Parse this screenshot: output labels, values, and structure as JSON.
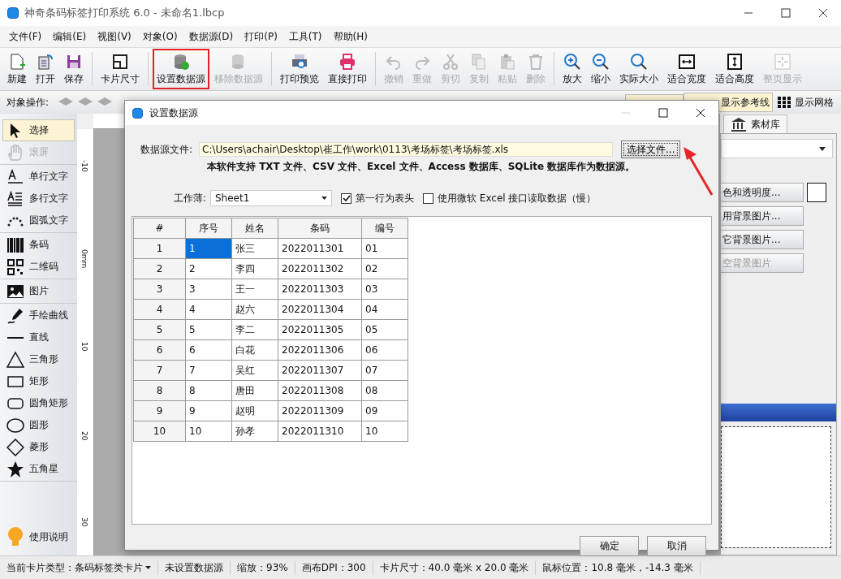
{
  "window": {
    "title": "神奇条码标签打印系统 6.0 - 未命名1.lbcp"
  },
  "menu": [
    "文件(F)",
    "编辑(E)",
    "视图(V)",
    "对象(O)",
    "数据源(D)",
    "打印(P)",
    "工具(T)",
    "帮助(H)"
  ],
  "toolbar": [
    [
      {
        "label": "新建",
        "disabled": false,
        "marked": false
      },
      {
        "label": "打开",
        "disabled": false,
        "marked": false
      },
      {
        "label": "保存",
        "disabled": false,
        "marked": false
      }
    ],
    [
      {
        "label": "卡片尺寸",
        "disabled": false,
        "marked": false
      }
    ],
    [
      {
        "label": "设置数据源",
        "disabled": false,
        "marked": true
      },
      {
        "label": "移除数据源",
        "disabled": true,
        "marked": false
      }
    ],
    [
      {
        "label": "打印预览",
        "disabled": false,
        "marked": false
      },
      {
        "label": "直接打印",
        "disabled": false,
        "marked": false
      }
    ],
    [
      {
        "label": "撤销",
        "disabled": true,
        "marked": false
      },
      {
        "label": "重做",
        "disabled": true,
        "marked": false
      },
      {
        "label": "剪切",
        "disabled": true,
        "marked": false
      },
      {
        "label": "复制",
        "disabled": true,
        "marked": false
      },
      {
        "label": "粘贴",
        "disabled": true,
        "marked": false
      },
      {
        "label": "删除",
        "disabled": true,
        "marked": false
      }
    ],
    [
      {
        "label": "放大",
        "disabled": false,
        "marked": false
      },
      {
        "label": "缩小",
        "disabled": false,
        "marked": false
      },
      {
        "label": "实际大小",
        "disabled": false,
        "marked": false
      },
      {
        "label": "适合宽度",
        "disabled": false,
        "marked": false
      },
      {
        "label": "适合高度",
        "disabled": false,
        "marked": false
      },
      {
        "label": "整页显示",
        "disabled": true,
        "marked": false
      }
    ]
  ],
  "object_bar": {
    "label": "对象操作:",
    "toggles": [
      {
        "label": "显示参考线",
        "on": true
      },
      {
        "label": "显示网格",
        "on": false
      }
    ]
  },
  "tools": [
    [
      {
        "label": "选择",
        "selected": true,
        "disabled": false
      },
      {
        "label": "滚屏",
        "selected": false,
        "disabled": true
      }
    ],
    [
      {
        "label": "单行文字",
        "selected": false,
        "disabled": false
      },
      {
        "label": "多行文字",
        "selected": false,
        "disabled": false
      },
      {
        "label": "圆弧文字",
        "selected": false,
        "disabled": false
      }
    ],
    [
      {
        "label": "条码",
        "selected": false,
        "disabled": false
      },
      {
        "label": "二维码",
        "selected": false,
        "disabled": false
      }
    ],
    [
      {
        "label": "图片",
        "selected": false,
        "disabled": false
      }
    ],
    [
      {
        "label": "手绘曲线",
        "selected": false,
        "disabled": false
      },
      {
        "label": "直线",
        "selected": false,
        "disabled": false
      },
      {
        "label": "三角形",
        "selected": false,
        "disabled": false
      },
      {
        "label": "矩形",
        "selected": false,
        "disabled": false
      },
      {
        "label": "圆角矩形",
        "selected": false,
        "disabled": false
      },
      {
        "label": "圆形",
        "selected": false,
        "disabled": false
      },
      {
        "label": "菱形",
        "selected": false,
        "disabled": false
      },
      {
        "label": "五角星",
        "selected": false,
        "disabled": false
      }
    ]
  ],
  "help": "使用说明",
  "ruler": [
    "-10",
    "0mm",
    "10",
    "20",
    "30"
  ],
  "right_panel": {
    "tab": "素材库",
    "buttons": [
      {
        "label": "色和透明度...",
        "disabled": false
      },
      {
        "label": "用背景图片...",
        "disabled": false
      },
      {
        "label": "它背景图片...",
        "disabled": false
      },
      {
        "label": "空背景图片",
        "disabled": true
      }
    ]
  },
  "dialog": {
    "title": "设置数据源",
    "file_label": "数据源文件:",
    "file_value": "C:\\Users\\achair\\Desktop\\崔工作\\work\\0113\\考场标签\\考场标签.xls",
    "browse": "选择文件...",
    "note": "本软件支持 TXT 文件、CSV 文件、Excel 文件、Access 数据库、SQLite 数据库作为数据源。",
    "sheet_label": "工作薄:",
    "sheet": "Sheet1",
    "options": [
      {
        "label": "第一行为表头",
        "checked": true
      },
      {
        "label": "使用微软 Excel 接口读取数据（慢）",
        "checked": false
      }
    ],
    "table": {
      "columns": [
        "#",
        "序号",
        "姓名",
        "条码",
        "编号"
      ],
      "rows": [
        {
          "cells": [
            {
              "text": "1",
              "selected": false
            },
            {
              "text": "1",
              "selected": true
            },
            {
              "text": "张三",
              "selected": false
            },
            {
              "text": "2022011301",
              "selected": false
            },
            {
              "text": "01",
              "selected": false
            }
          ]
        },
        {
          "cells": [
            {
              "text": "2",
              "selected": false
            },
            {
              "text": "2",
              "selected": false
            },
            {
              "text": "李四",
              "selected": false
            },
            {
              "text": "2022011302",
              "selected": false
            },
            {
              "text": "02",
              "selected": false
            }
          ]
        },
        {
          "cells": [
            {
              "text": "3",
              "selected": false
            },
            {
              "text": "3",
              "selected": false
            },
            {
              "text": "王一",
              "selected": false
            },
            {
              "text": "2022011303",
              "selected": false
            },
            {
              "text": "03",
              "selected": false
            }
          ]
        },
        {
          "cells": [
            {
              "text": "4",
              "selected": false
            },
            {
              "text": "4",
              "selected": false
            },
            {
              "text": "赵六",
              "selected": false
            },
            {
              "text": "2022011304",
              "selected": false
            },
            {
              "text": "04",
              "selected": false
            }
          ]
        },
        {
          "cells": [
            {
              "text": "5",
              "selected": false
            },
            {
              "text": "5",
              "selected": false
            },
            {
              "text": "李二",
              "selected": false
            },
            {
              "text": "2022011305",
              "selected": false
            },
            {
              "text": "05",
              "selected": false
            }
          ]
        },
        {
          "cells": [
            {
              "text": "6",
              "selected": false
            },
            {
              "text": "6",
              "selected": false
            },
            {
              "text": "白花",
              "selected": false
            },
            {
              "text": "2022011306",
              "selected": false
            },
            {
              "text": "06",
              "selected": false
            }
          ]
        },
        {
          "cells": [
            {
              "text": "7",
              "selected": false
            },
            {
              "text": "7",
              "selected": false
            },
            {
              "text": "吴红",
              "selected": false
            },
            {
              "text": "2022011307",
              "selected": false
            },
            {
              "text": "07",
              "selected": false
            }
          ]
        },
        {
          "cells": [
            {
              "text": "8",
              "selected": false
            },
            {
              "text": "8",
              "selected": false
            },
            {
              "text": "唐田",
              "selected": false
            },
            {
              "text": "2022011308",
              "selected": false
            },
            {
              "text": "08",
              "selected": false
            }
          ]
        },
        {
          "cells": [
            {
              "text": "9",
              "selected": false
            },
            {
              "text": "9",
              "selected": false
            },
            {
              "text": "赵明",
              "selected": false
            },
            {
              "text": "2022011309",
              "selected": false
            },
            {
              "text": "09",
              "selected": false
            }
          ]
        },
        {
          "cells": [
            {
              "text": "10",
              "selected": false
            },
            {
              "text": "10",
              "selected": false
            },
            {
              "text": "孙孝",
              "selected": false
            },
            {
              "text": "2022011310",
              "selected": false
            },
            {
              "text": "10",
              "selected": false
            }
          ]
        }
      ]
    },
    "ok": "确定",
    "cancel": "取消"
  },
  "status_bar": [
    {
      "text": "当前卡片类型：条码标签类卡片",
      "kind": "dropdown"
    },
    {
      "text": "未设置数据源",
      "kind": "text"
    },
    {
      "text": "缩放：93%",
      "kind": "text"
    },
    {
      "text": "画布DPI：300",
      "kind": "text"
    },
    {
      "text": "卡片尺寸：40.0 毫米 x 20.0 毫米",
      "kind": "text"
    },
    {
      "text": "鼠标位置：10.8 毫米，-14.3 毫米",
      "kind": "text"
    }
  ]
}
